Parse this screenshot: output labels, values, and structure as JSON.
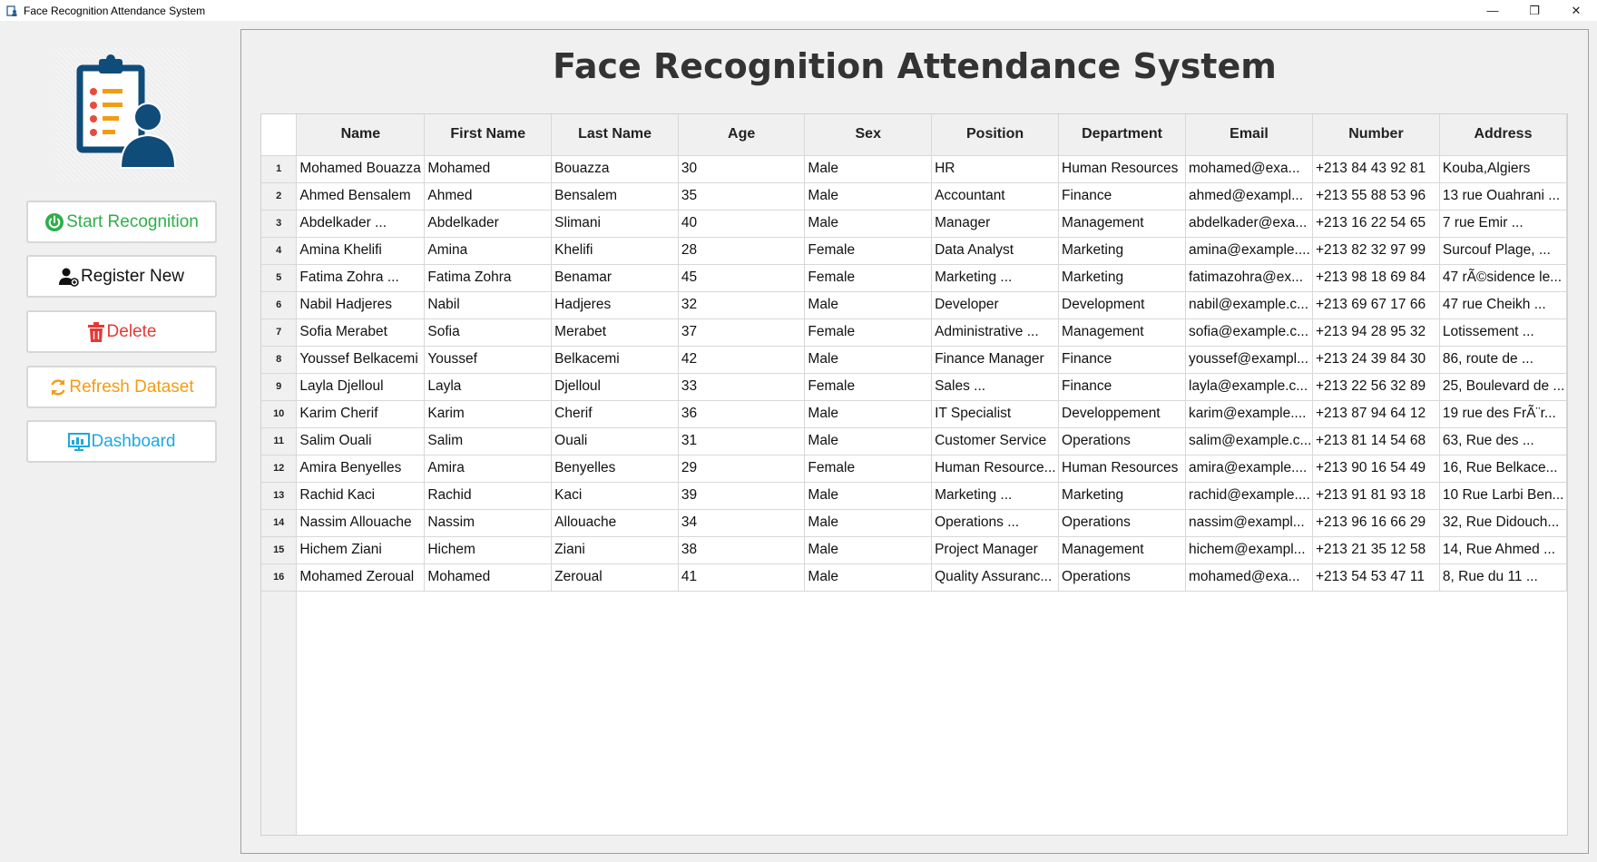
{
  "window": {
    "title": "Face Recognition Attendance System",
    "controls": {
      "minimize": "—",
      "maximize": "❐",
      "close": "✕"
    }
  },
  "sidebar": {
    "buttons": [
      {
        "label": "Start Recognition",
        "icon": "power-icon",
        "color": "#2fae4a"
      },
      {
        "label": "Register New",
        "icon": "user-add-icon",
        "color": "#111111"
      },
      {
        "label": "Delete",
        "icon": "trash-icon",
        "color": "#e53935"
      },
      {
        "label": "Refresh Dataset",
        "icon": "refresh-icon",
        "color": "#f39c12"
      },
      {
        "label": "Dashboard",
        "icon": "dashboard-icon",
        "color": "#1ea7e0"
      }
    ]
  },
  "main": {
    "title": "Face Recognition Attendance System"
  },
  "table": {
    "columns": [
      "Name",
      "First Name",
      "Last Name",
      "Age",
      "Sex",
      "Position",
      "Department",
      "Email",
      "Number",
      "Address"
    ],
    "rows": [
      [
        "1",
        "Mohamed Bouazza",
        "Mohamed",
        "Bouazza",
        "30",
        "Male",
        "HR",
        "Human Resources",
        "mohamed@exa...",
        "+213 84 43 92 81",
        "Kouba,Algiers"
      ],
      [
        "2",
        "Ahmed Bensalem",
        "Ahmed",
        "Bensalem",
        "35",
        "Male",
        "Accountant",
        "Finance",
        "ahmed@exampl...",
        "+213 55 88 53 96",
        "13 rue Ouahrani ..."
      ],
      [
        "3",
        "Abdelkader ...",
        "Abdelkader",
        "Slimani",
        "40",
        "Male",
        "Manager",
        "Management",
        "abdelkader@exa...",
        "+213 16 22 54 65",
        "7 rue Emir ..."
      ],
      [
        "4",
        "Amina Khelifi",
        "Amina",
        "Khelifi",
        "28",
        "Female",
        "Data Analyst",
        "Marketing",
        "amina@example....",
        "+213 82 32 97 99",
        "Surcouf Plage, ..."
      ],
      [
        "5",
        "Fatima Zohra ...",
        "Fatima Zohra",
        "Benamar",
        "45",
        "Female",
        "Marketing ...",
        "Marketing",
        "fatimazohra@ex...",
        "+213 98 18 69 84",
        "47 rÃ©sidence le..."
      ],
      [
        "6",
        "Nabil Hadjeres",
        "Nabil",
        "Hadjeres",
        "32",
        "Male",
        "Developer",
        "Development",
        "nabil@example.c...",
        "+213 69 67 17 66",
        "47 rue Cheikh ..."
      ],
      [
        "7",
        "Sofia Merabet",
        "Sofia",
        "Merabet",
        "37",
        "Female",
        "Administrative ...",
        "Management",
        "sofia@example.c...",
        "+213 94 28 95 32",
        "Lotissement ..."
      ],
      [
        "8",
        "Youssef Belkacemi",
        "Youssef",
        "Belkacemi",
        "42",
        "Male",
        "Finance Manager",
        "Finance",
        "youssef@exampl...",
        "+213 24 39 84 30",
        "86, route de ..."
      ],
      [
        "9",
        "Layla Djelloul",
        "Layla",
        "Djelloul",
        "33",
        "Female",
        "Sales ...",
        "Finance",
        "layla@example.c...",
        "+213 22 56 32 89",
        "25, Boulevard de ..."
      ],
      [
        "10",
        "Karim Cherif",
        "Karim",
        "Cherif",
        "36",
        "Male",
        "IT Specialist",
        "Developpement",
        "karim@example....",
        "+213 87 94 64 12",
        "19 rue des FrÃ¨r..."
      ],
      [
        "11",
        "Salim Ouali",
        "Salim",
        "Ouali",
        "31",
        "Male",
        "Customer Service",
        "Operations",
        "salim@example.c...",
        "+213 81 14 54 68",
        "63, Rue des ..."
      ],
      [
        "12",
        "Amira Benyelles",
        "Amira",
        "Benyelles",
        "29",
        "Female",
        "Human Resource...",
        "Human Resources",
        "amira@example....",
        "+213 90 16 54 49",
        "16, Rue Belkace..."
      ],
      [
        "13",
        "Rachid Kaci",
        "Rachid",
        "Kaci",
        "39",
        "Male",
        "Marketing ...",
        "Marketing",
        "rachid@example....",
        "+213 91 81 93 18",
        "10 Rue Larbi Ben..."
      ],
      [
        "14",
        "Nassim Allouache",
        "Nassim",
        "Allouache",
        "34",
        "Male",
        "Operations ...",
        "Operations",
        "nassim@exampl...",
        "+213 96 16 66 29",
        "32, Rue Didouch..."
      ],
      [
        "15",
        "Hichem Ziani",
        "Hichem",
        "Ziani",
        "38",
        "Male",
        "Project Manager",
        "Management",
        "hichem@exampl...",
        "+213 21 35 12 58",
        "14, Rue Ahmed ..."
      ],
      [
        "16",
        "Mohamed Zeroual",
        "Mohamed",
        "Zeroual",
        "41",
        "Male",
        "Quality Assuranc...",
        "Operations",
        "mohamed@exa...",
        "+213 54 53 47 11",
        "8, Rue du 11 ..."
      ]
    ]
  }
}
